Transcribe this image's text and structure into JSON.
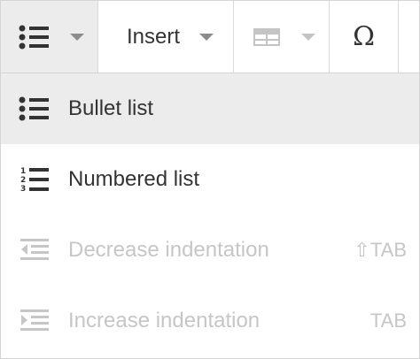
{
  "toolbar": {
    "insert_label": "Insert",
    "omega_glyph": "Ω"
  },
  "menu": {
    "items": [
      {
        "label": "Bullet list",
        "shortcut": "",
        "enabled": true,
        "active": true,
        "icon": "bullet-list-icon"
      },
      {
        "label": "Numbered list",
        "shortcut": "",
        "enabled": true,
        "active": false,
        "icon": "numbered-list-icon"
      },
      {
        "label": "Decrease indentation",
        "shortcut": "⇧TAB",
        "enabled": false,
        "active": false,
        "icon": "outdent-icon"
      },
      {
        "label": "Increase indentation",
        "shortcut": "TAB",
        "enabled": false,
        "active": false,
        "icon": "indent-icon"
      }
    ]
  },
  "colors": {
    "text": "#333333",
    "disabled_text": "#c6c6c6",
    "active_bg": "#ececec",
    "border": "#d4d4d4"
  }
}
